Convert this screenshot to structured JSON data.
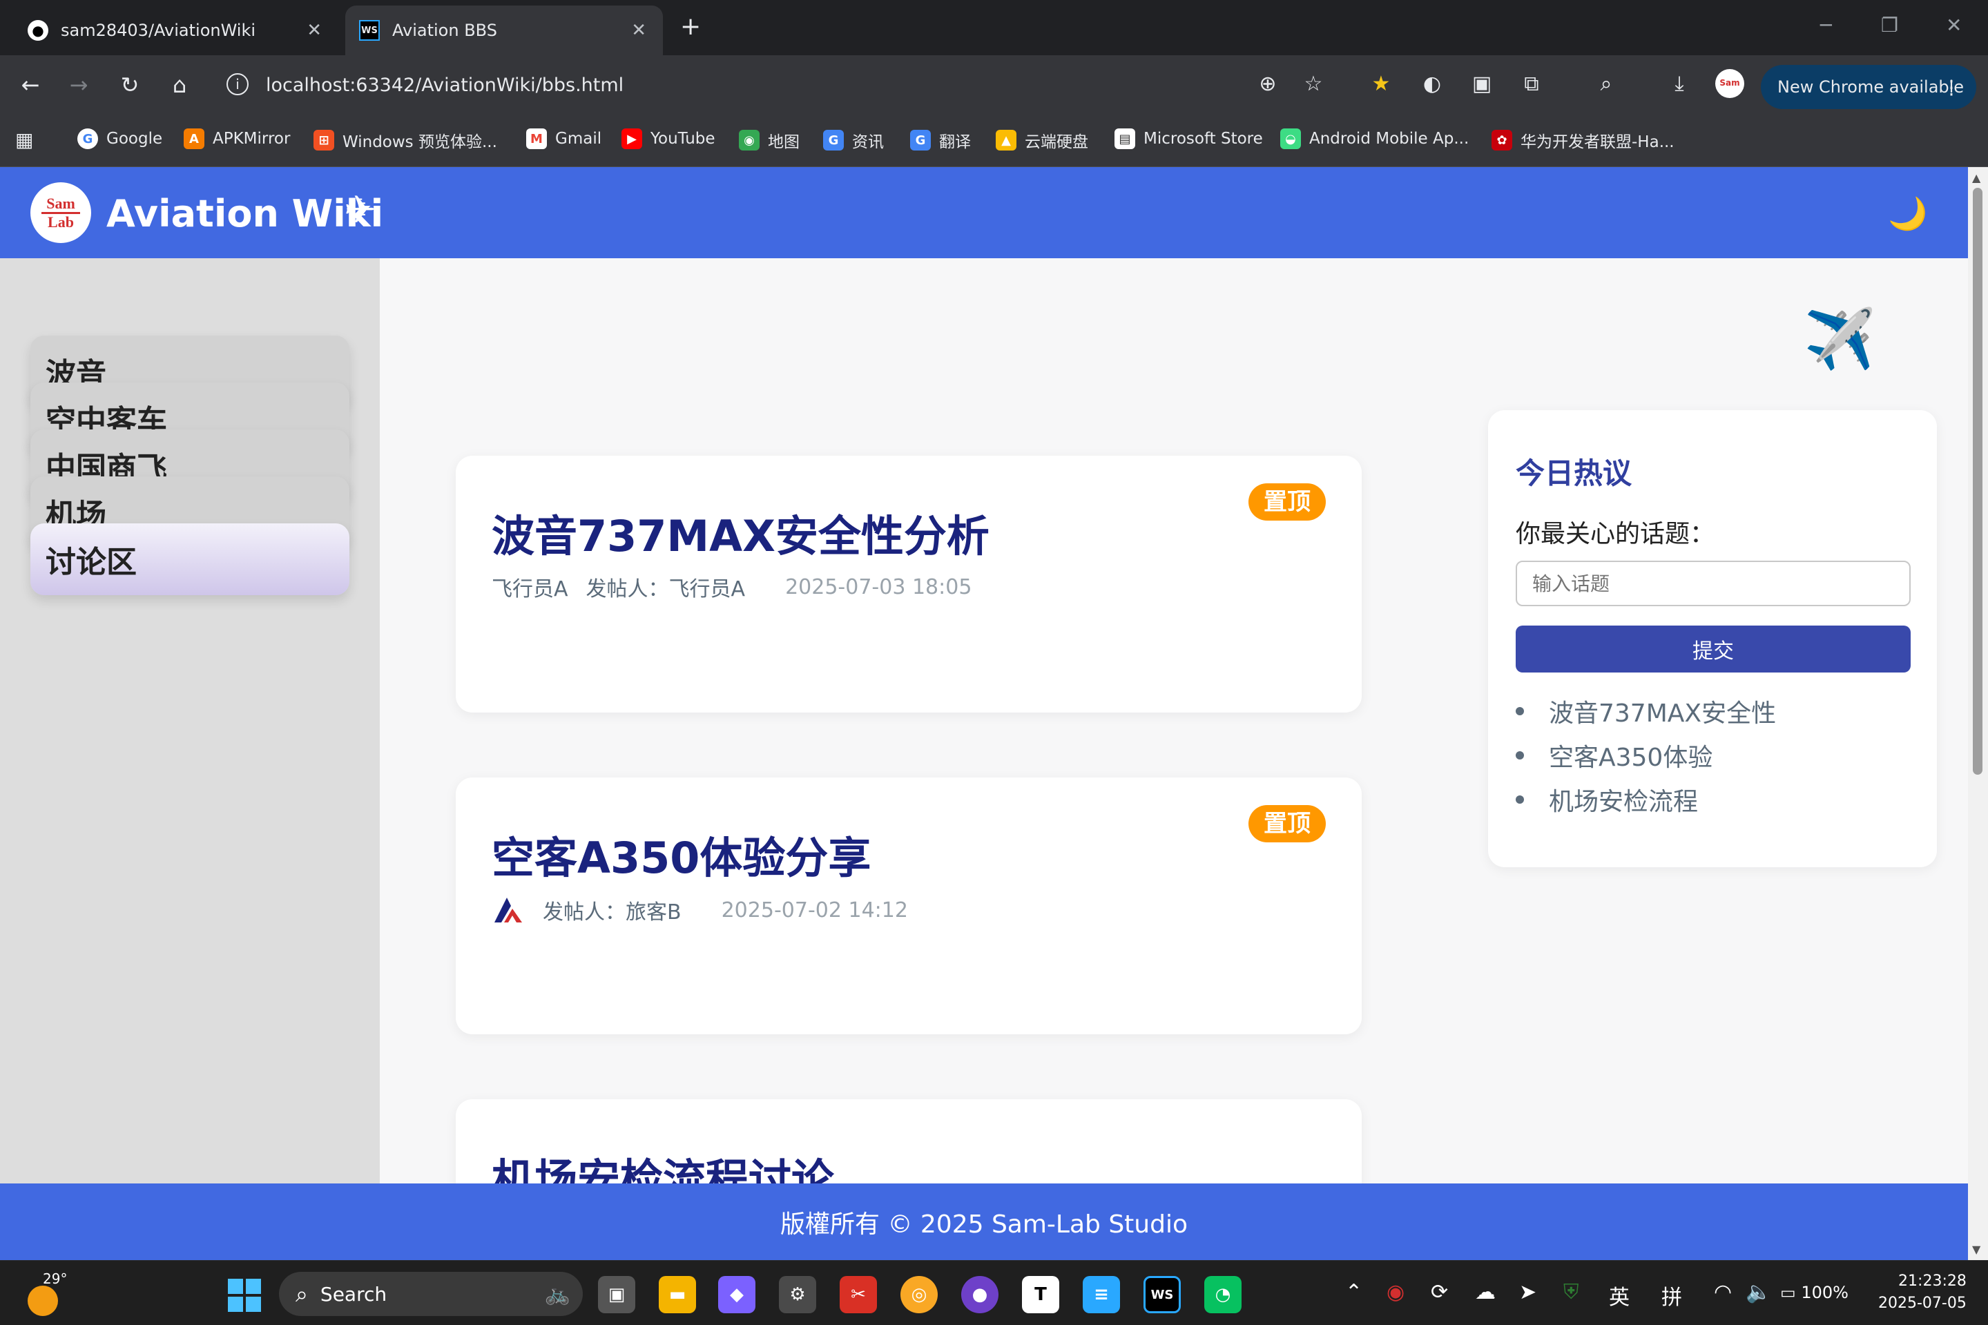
{
  "browser": {
    "tabs": [
      {
        "title": "sam28403/AviationWiki",
        "icon": "github-icon"
      },
      {
        "title": "Aviation BBS",
        "icon": "webstorm-icon"
      }
    ],
    "url": "localhost:63342/AviationWiki/bbs.html",
    "update_button": "New Chrome available",
    "bookmarks": [
      "Google",
      "APKMirror",
      "Windows 预览体验...",
      "Gmail",
      "YouTube",
      "地图",
      "资讯",
      "翻译",
      "云端硬盘",
      "Microsoft Store",
      "Android Mobile Ap...",
      "华为开发者联盟-Ha..."
    ]
  },
  "site": {
    "logo_top": "Sam",
    "logo_bottom": "Lab",
    "title": "Aviation Wiki",
    "title_icon": "✈",
    "theme_icon": "🌙",
    "float_icon": "✈️"
  },
  "sidebar": {
    "items": [
      {
        "label": "波音",
        "active": false
      },
      {
        "label": "空中客车",
        "active": false
      },
      {
        "label": "中国商飞",
        "active": false
      },
      {
        "label": "机场",
        "active": false
      },
      {
        "label": "讨论区",
        "active": true
      }
    ]
  },
  "posts": [
    {
      "title": "波音737MAX安全性分析",
      "pinned": "置顶",
      "avatar_alt": "飞行员A",
      "author": "发帖人：飞行员A",
      "time": "2025-07-03 18:05"
    },
    {
      "title": "空客A350体验分享",
      "pinned": "置顶",
      "author": "发帖人：旅客B",
      "time": "2025-07-02 14:12"
    },
    {
      "title": "机场安检流程讨论"
    }
  ],
  "hot": {
    "title": "今日热议",
    "label": "你最关心的话题：",
    "placeholder": "输入话题",
    "submit": "提交",
    "topics": [
      "波音737MAX安全性",
      "空客A350体验",
      "机场安检流程"
    ]
  },
  "footer": {
    "text": "版權所有 © 2025 Sam-Lab Studio"
  },
  "taskbar": {
    "temperature": "29°",
    "search": "Search",
    "ime_lang": "英",
    "ime_mode": "拼",
    "battery": "100%",
    "time": "21:23:28",
    "date": "2025-07-05"
  }
}
